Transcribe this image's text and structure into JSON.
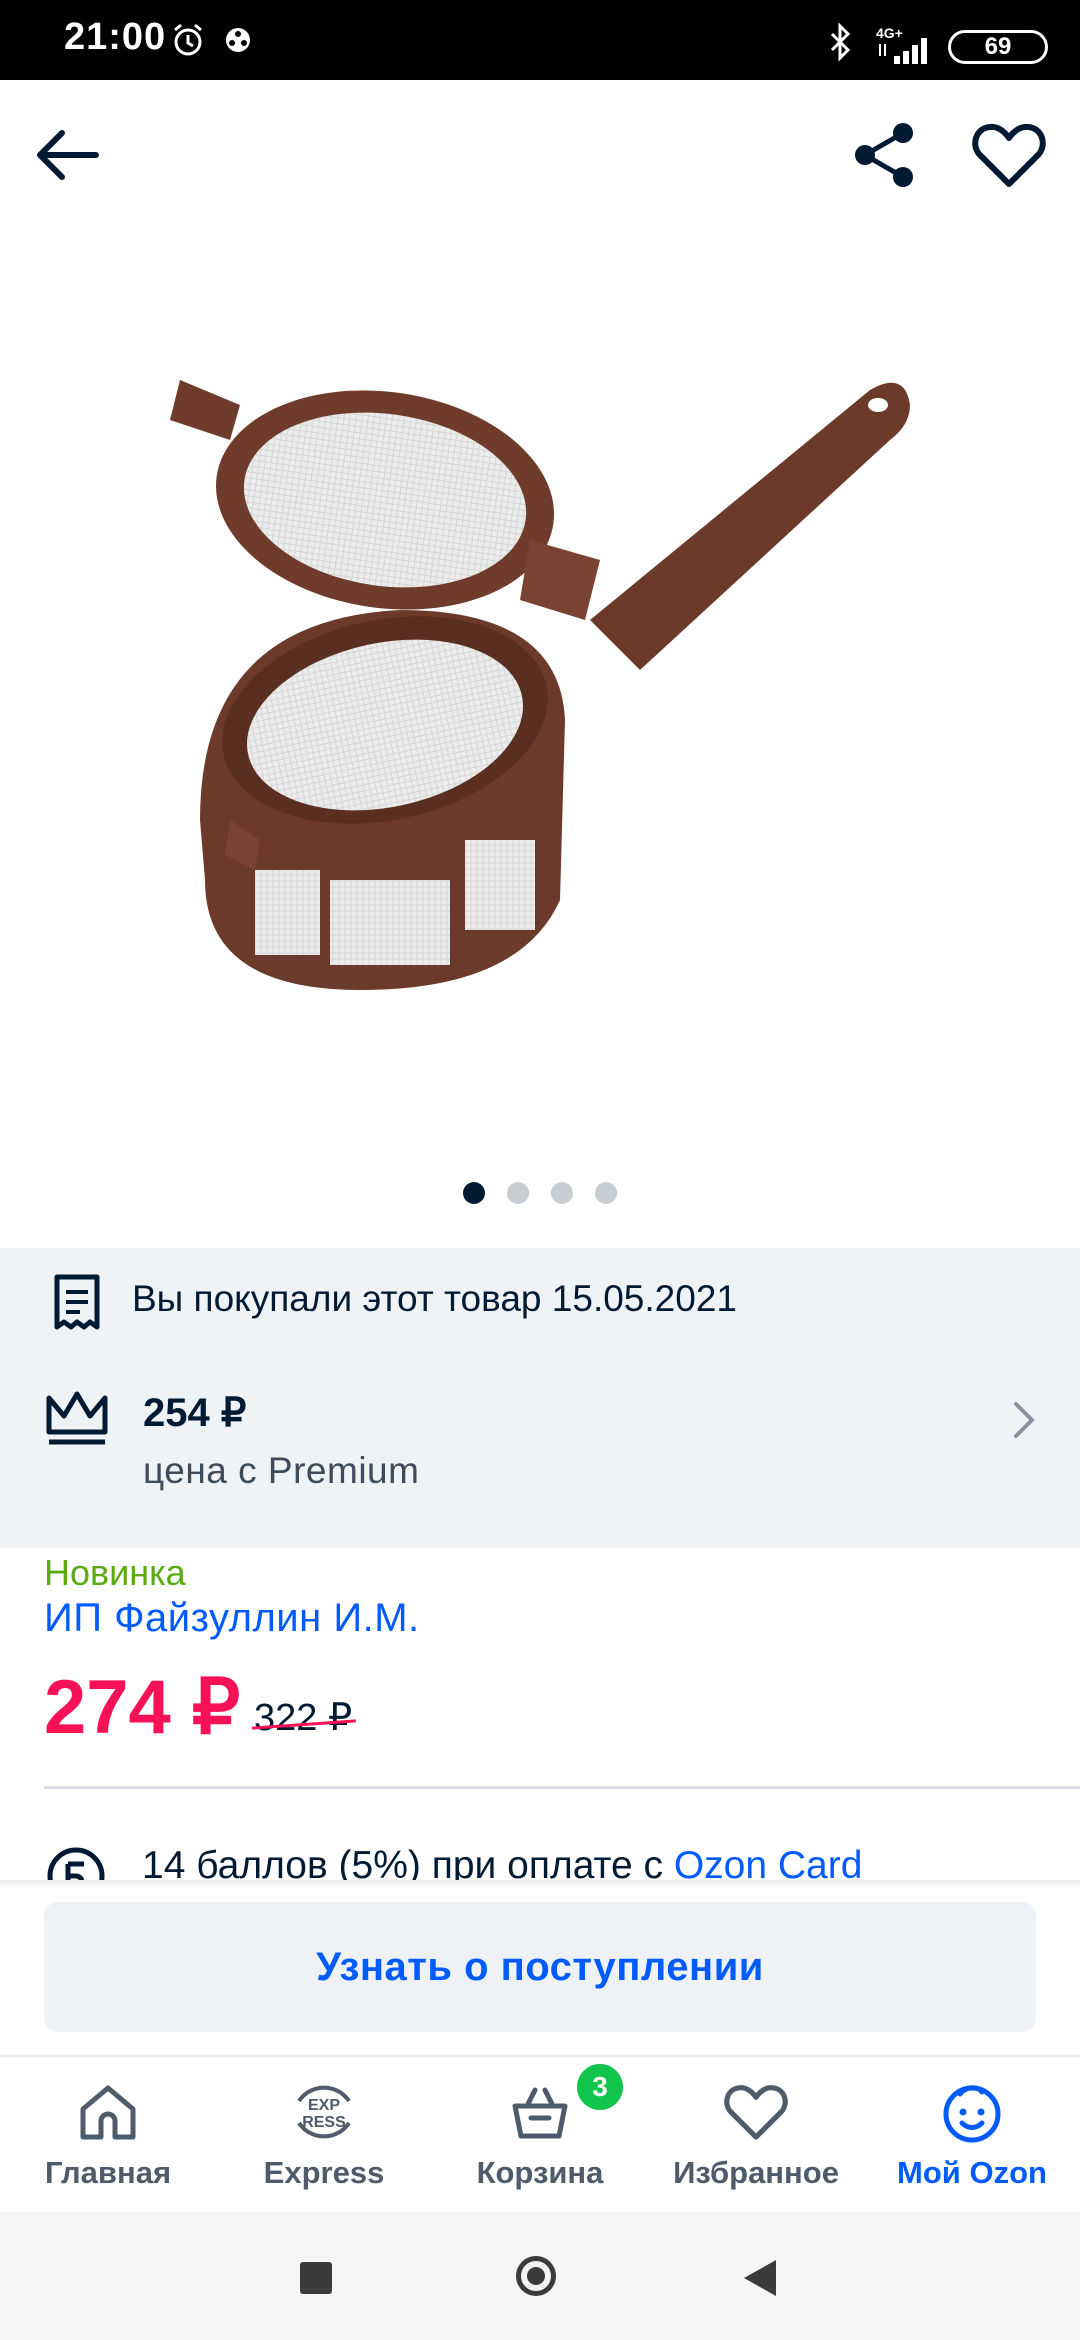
{
  "status_bar": {
    "time": "21:00",
    "network": "4G+",
    "battery": "69"
  },
  "gallery": {
    "dots_count": 4,
    "active_index": 0
  },
  "purchase_notice": {
    "text": "Вы покупали этот товар 15.05.2021"
  },
  "premium": {
    "price": "254 ₽",
    "label": "цена с Premium"
  },
  "product": {
    "badge": "Новинка",
    "seller": "ИП Файзуллин И.М.",
    "price": "274 ₽",
    "old_price": "322 ₽"
  },
  "bonus": {
    "text": "14 баллов (5%) при оплате с ",
    "link": "Ozon Card"
  },
  "actions": {
    "notify_label": "Узнать о поступлении"
  },
  "tabbar": {
    "items": [
      {
        "label": "Главная",
        "icon": "home-icon"
      },
      {
        "label": "Express",
        "icon": "express-icon"
      },
      {
        "label": "Корзина",
        "icon": "cart-icon",
        "badge": "3"
      },
      {
        "label": "Избранное",
        "icon": "heart-icon"
      },
      {
        "label": "Мой Ozon",
        "icon": "profile-icon",
        "active": true
      }
    ]
  },
  "colors": {
    "accent": "#005bff",
    "price": "#f91155",
    "new_badge": "#5aab0f",
    "cart_badge": "#10c44c",
    "text": "#001a34"
  }
}
